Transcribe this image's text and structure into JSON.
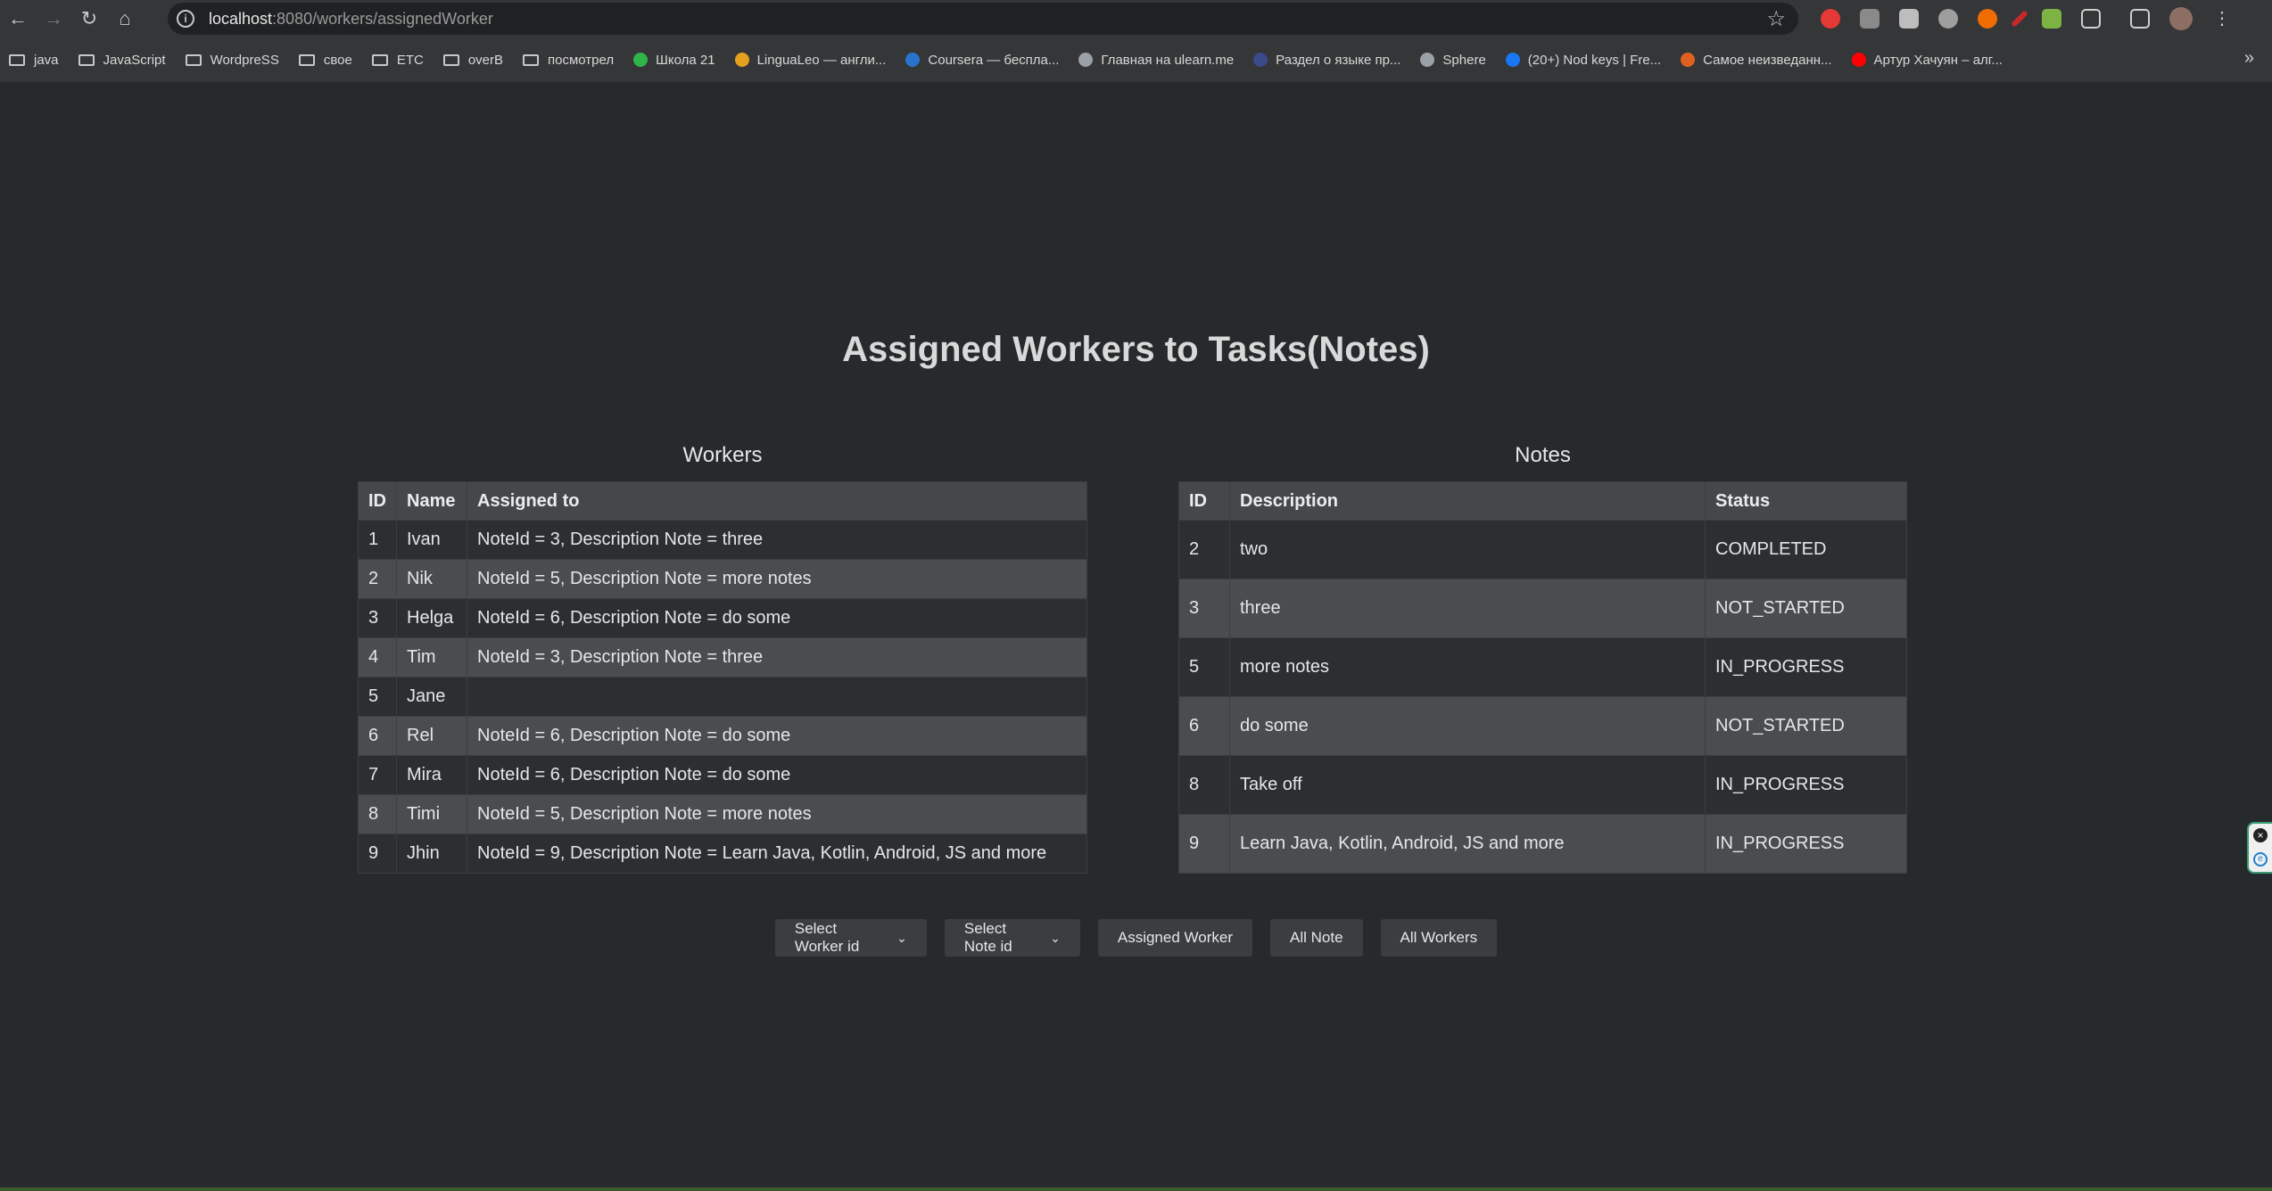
{
  "browser": {
    "url_host": "localhost",
    "url_rest": ":8080/workers/assignedWorker",
    "bookmarks": [
      {
        "label": "java",
        "type": "folder"
      },
      {
        "label": "JavaScript",
        "type": "folder"
      },
      {
        "label": "WordpreSS",
        "type": "folder"
      },
      {
        "label": "свое",
        "type": "folder"
      },
      {
        "label": "ETC",
        "type": "folder"
      },
      {
        "label": "overB",
        "type": "folder"
      },
      {
        "label": "посмотрел",
        "type": "folder"
      },
      {
        "label": "Школа 21",
        "type": "site",
        "color": "#2fb54a"
      },
      {
        "label": "LinguaLeo — англи...",
        "type": "site",
        "color": "#e6a020"
      },
      {
        "label": "Coursera — беспла...",
        "type": "site",
        "color": "#2a73cc"
      },
      {
        "label": "Главная на ulearn.me",
        "type": "site",
        "color": "#9aa0a6"
      },
      {
        "label": "Раздел о языке пр...",
        "type": "site",
        "color": "#3a4a8a"
      },
      {
        "label": "Sphere",
        "type": "site",
        "color": "#9aa0a6"
      },
      {
        "label": "(20+) Nod keys | Fre...",
        "type": "site",
        "color": "#1877f2"
      },
      {
        "label": "Самое неизведанн...",
        "type": "site",
        "color": "#e06020"
      },
      {
        "label": "Артур Хачуян – алг...",
        "type": "site",
        "color": "#ff0000"
      }
    ]
  },
  "page": {
    "title": "Assigned Workers to Tasks(Notes)"
  },
  "workers": {
    "title": "Workers",
    "headers": [
      "ID",
      "Name",
      "Assigned to"
    ],
    "rows": [
      [
        "1",
        "Ivan",
        "NoteId = 3, Description Note = three"
      ],
      [
        "2",
        "Nik",
        "NoteId = 5, Description Note = more notes"
      ],
      [
        "3",
        "Helga",
        "NoteId = 6, Description Note = do some"
      ],
      [
        "4",
        "Tim",
        "NoteId = 3, Description Note = three"
      ],
      [
        "5",
        "Jane",
        ""
      ],
      [
        "6",
        "Rel",
        "NoteId = 6, Description Note = do some"
      ],
      [
        "7",
        "Mira",
        "NoteId = 6, Description Note = do some"
      ],
      [
        "8",
        "Timi",
        "NoteId = 5, Description Note = more notes"
      ],
      [
        "9",
        "Jhin",
        "NoteId = 9, Description Note = Learn Java, Kotlin, Android, JS and more"
      ]
    ]
  },
  "notes": {
    "title": "Notes",
    "headers": [
      "ID",
      "Description",
      "Status"
    ],
    "rows": [
      [
        "2",
        "two",
        "COMPLETED"
      ],
      [
        "3",
        "three",
        "NOT_STARTED"
      ],
      [
        "5",
        "more notes",
        "IN_PROGRESS"
      ],
      [
        "6",
        "do some",
        "NOT_STARTED"
      ],
      [
        "8",
        "Take off",
        "IN_PROGRESS"
      ],
      [
        "9",
        "Learn Java, Kotlin, Android, JS and more",
        "IN_PROGRESS"
      ]
    ]
  },
  "controls": {
    "worker_select": "Select Worker id",
    "note_select": "Select Note id",
    "assign_button": "Assigned Worker",
    "all_note_button": "All Note",
    "all_workers_button": "All Workers"
  }
}
